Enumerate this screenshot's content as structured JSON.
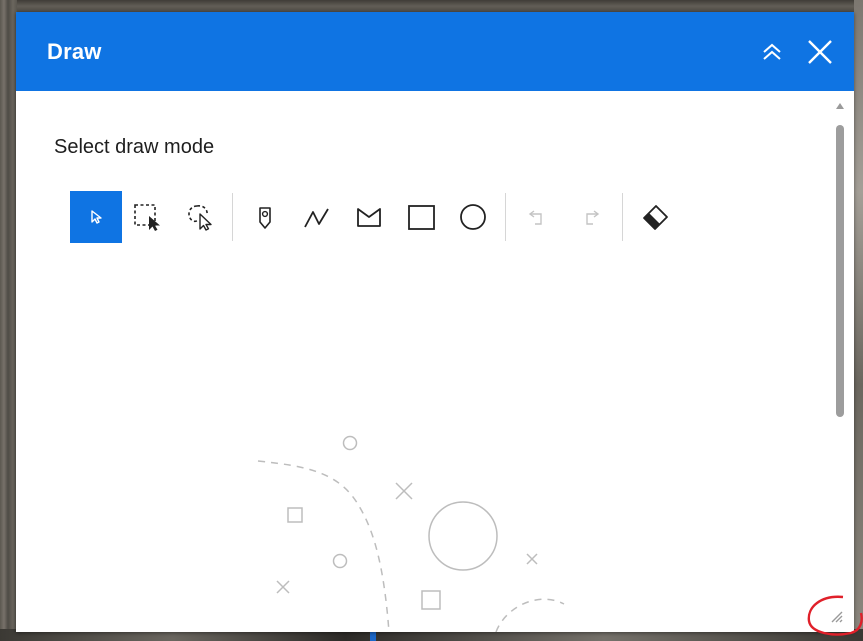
{
  "panel": {
    "title": "Draw",
    "collapse_icon": "double-chevron-up-icon",
    "close_icon": "close-icon"
  },
  "draw_mode": {
    "label": "Select draw mode",
    "tools": [
      {
        "name": "select",
        "icon": "select-arrow-icon",
        "active": true
      },
      {
        "name": "rectangle-select",
        "icon": "rectangle-select-icon",
        "active": false
      },
      {
        "name": "lasso-select",
        "icon": "lasso-select-icon",
        "active": false
      },
      {
        "name": "point",
        "icon": "point-pin-icon",
        "active": false
      },
      {
        "name": "polyline",
        "icon": "polyline-icon",
        "active": false
      },
      {
        "name": "polygon",
        "icon": "polygon-icon",
        "active": false
      },
      {
        "name": "rectangle",
        "icon": "rectangle-icon",
        "active": false
      },
      {
        "name": "circle",
        "icon": "circle-icon",
        "active": false
      },
      {
        "name": "undo",
        "icon": "undo-icon",
        "active": false,
        "disabled": true
      },
      {
        "name": "redo",
        "icon": "redo-icon",
        "active": false,
        "disabled": true
      },
      {
        "name": "clear",
        "icon": "eraser-icon",
        "active": false
      }
    ]
  },
  "colors": {
    "accent": "#0f74e3",
    "annotation": "#e0202a",
    "placeholder_stroke": "#bdbdbd"
  }
}
